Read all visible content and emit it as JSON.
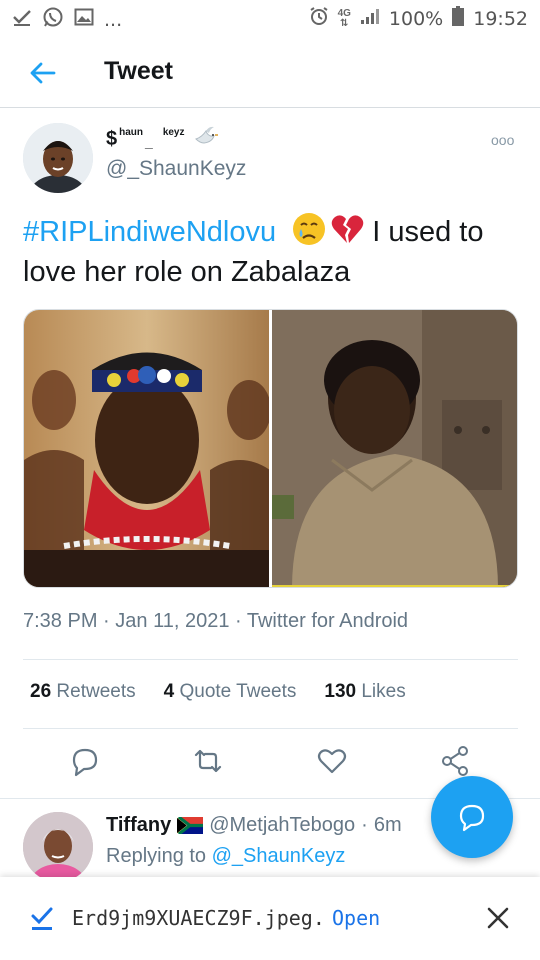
{
  "status_bar": {
    "left_icons": [
      "check-icon",
      "whatsapp-icon",
      "gallery-icon",
      "more-dots"
    ],
    "more": "...",
    "network": "4G",
    "battery": "100%",
    "time": "19:52"
  },
  "appbar": {
    "title": "Tweet"
  },
  "tweet": {
    "display_name": {
      "dollar": "$",
      "part1": "haun",
      "dash": "_",
      "part2": "keyz"
    },
    "handle": "@_ShaunKeyz",
    "more": "ooo",
    "hashtag": "#RIPLindiweNdlovu",
    "text_after_emoji": " I used to love her role on Zabalaza",
    "time": "7:38 PM",
    "date": "Jan 11, 2021",
    "source": "Twitter for Android",
    "meta_sep": " · ",
    "stats": {
      "retweets_count": "26",
      "retweets_label": "Retweets",
      "quotes_count": "4",
      "quotes_label": "Quote Tweets",
      "likes_count": "130",
      "likes_label": "Likes"
    }
  },
  "reply": {
    "name": "Tiffany",
    "handle": "@MetjahTebogo",
    "sep": "·",
    "time": "6m",
    "replying_prefix": "Replying to ",
    "replying_to": "@_ShaunKeyz"
  },
  "snackbar": {
    "filename": "Erd9jm9XUAECZ9F.jpeg.",
    "action": "Open"
  },
  "colors": {
    "accent": "#1da1f2",
    "text": "#14171a",
    "muted": "#657786"
  }
}
